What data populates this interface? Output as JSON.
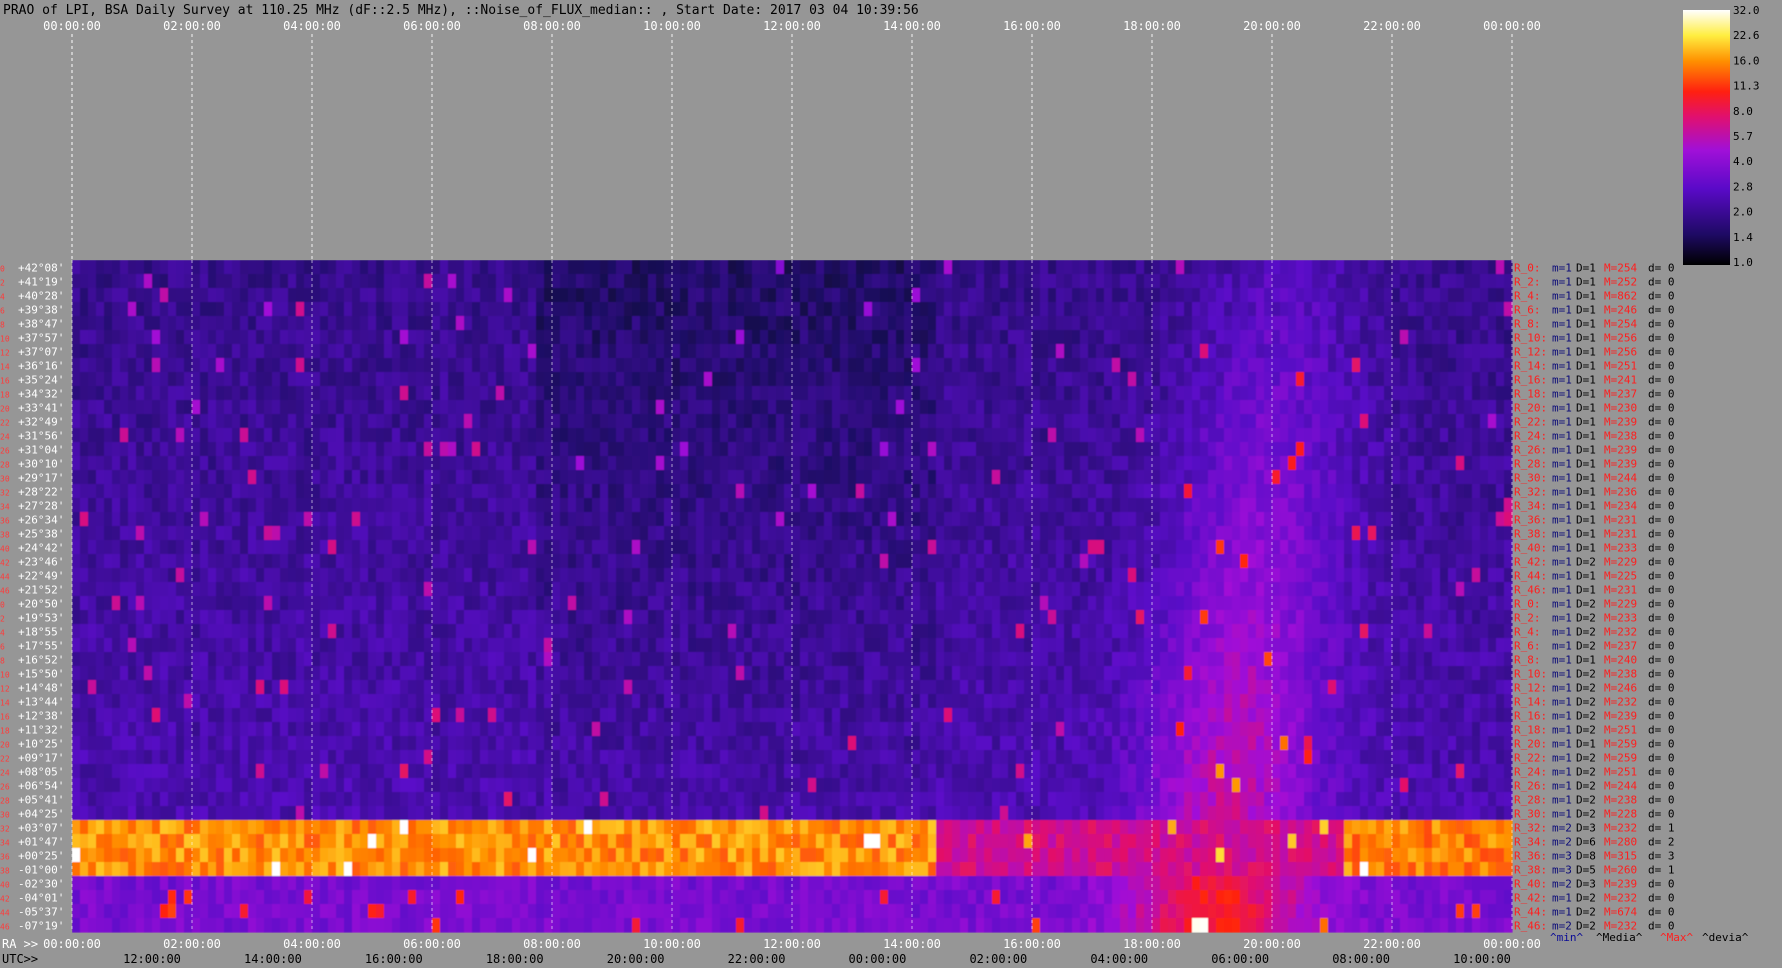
{
  "title": "PRAO of LPI, BSA Daily Survey at 110.25 MHz (dF::2.5 MHz), ::Noise_of_FLUX_median:: , Start Date: 2017 03 04 10:39:56",
  "colors": {
    "background": "#969696",
    "grid_dashed": "#ffffff",
    "title_text": "#000000",
    "ticks_top": "#ffffff",
    "row_index": "#ff3a3a",
    "dec_text": "#ffffff",
    "stat_r": "#ff1e1e",
    "stat_min": "#0a0a78",
    "stat_max": "#ff1e1e",
    "legend_min": "#0a0a96",
    "legend_media": "#000000",
    "legend_max": "#ff1e1e",
    "legend_devia": "#000000"
  },
  "chart_data": {
    "type": "heatmap",
    "title": "PRAO of LPI, BSA Daily Survey at 110.25 MHz (dF::2.5 MHz), ::Noise_of_FLUX_median:: , Start Date: 2017 03 04 10:39:56",
    "top_axis_ticks": [
      "00:00:00",
      "02:00:00",
      "04:00:00",
      "06:00:00",
      "08:00:00",
      "10:00:00",
      "12:00:00",
      "14:00:00",
      "16:00:00",
      "18:00:00",
      "20:00:00",
      "22:00:00",
      "00:00:00"
    ],
    "ra_axis": {
      "label": "RA >>",
      "ticks": [
        "00:00:00",
        "02:00:00",
        "04:00:00",
        "06:00:00",
        "08:00:00",
        "10:00:00",
        "12:00:00",
        "14:00:00",
        "16:00:00",
        "18:00:00",
        "20:00:00",
        "22:00:00",
        "00:00:00"
      ]
    },
    "utc_axis": {
      "label": "UTC>>",
      "ticks": [
        "12:00:00",
        "14:00:00",
        "16:00:00",
        "18:00:00",
        "20:00:00",
        "22:00:00",
        "00:00:00",
        "02:00:00",
        "04:00:00",
        "06:00:00",
        "08:00:00",
        "10:00:00"
      ]
    },
    "colorbar": {
      "labels": [
        "32.0",
        "22.6",
        "16.0",
        "11.3",
        "8.0",
        "5.7",
        "4.0",
        "2.8",
        "2.0",
        "1.4",
        "1.0"
      ]
    },
    "legend": {
      "min": "^min^",
      "media": "^Media^",
      "max": "^Max^",
      "devia": "^devia^"
    },
    "rows": [
      {
        "idx": "0",
        "dec": "+42°08'",
        "r": "R_0:",
        "m": "m=1",
        "D": "D=1",
        "M": "M=254",
        "d": "d= 0"
      },
      {
        "idx": "2",
        "dec": "+41°19'",
        "r": "R_2:",
        "m": "m=1",
        "D": "D=1",
        "M": "M=252",
        "d": "d= 0"
      },
      {
        "idx": "4",
        "dec": "+40°28'",
        "r": "R_4:",
        "m": "m=1",
        "D": "D=1",
        "M": "M=862",
        "d": "d= 0"
      },
      {
        "idx": "6",
        "dec": "+39°38'",
        "r": "R_6:",
        "m": "m=1",
        "D": "D=1",
        "M": "M=246",
        "d": "d= 0"
      },
      {
        "idx": "8",
        "dec": "+38°47'",
        "r": "R_8:",
        "m": "m=1",
        "D": "D=1",
        "M": "M=254",
        "d": "d= 0"
      },
      {
        "idx": "10",
        "dec": "+37°57'",
        "r": "R_10:",
        "m": "m=1",
        "D": "D=1",
        "M": "M=256",
        "d": "d= 0"
      },
      {
        "idx": "12",
        "dec": "+37°07'",
        "r": "R_12:",
        "m": "m=1",
        "D": "D=1",
        "M": "M=256",
        "d": "d= 0"
      },
      {
        "idx": "14",
        "dec": "+36°16'",
        "r": "R_14:",
        "m": "m=1",
        "D": "D=1",
        "M": "M=251",
        "d": "d= 0"
      },
      {
        "idx": "16",
        "dec": "+35°24'",
        "r": "R_16:",
        "m": "m=1",
        "D": "D=1",
        "M": "M=241",
        "d": "d= 0"
      },
      {
        "idx": "18",
        "dec": "+34°32'",
        "r": "R_18:",
        "m": "m=1",
        "D": "D=1",
        "M": "M=237",
        "d": "d= 0"
      },
      {
        "idx": "20",
        "dec": "+33°41'",
        "r": "R_20:",
        "m": "m=1",
        "D": "D=1",
        "M": "M=230",
        "d": "d= 0"
      },
      {
        "idx": "22",
        "dec": "+32°49'",
        "r": "R_22:",
        "m": "m=1",
        "D": "D=1",
        "M": "M=239",
        "d": "d= 0"
      },
      {
        "idx": "24",
        "dec": "+31°56'",
        "r": "R_24:",
        "m": "m=1",
        "D": "D=1",
        "M": "M=238",
        "d": "d= 0"
      },
      {
        "idx": "26",
        "dec": "+31°04'",
        "r": "R_26:",
        "m": "m=1",
        "D": "D=1",
        "M": "M=239",
        "d": "d= 0"
      },
      {
        "idx": "28",
        "dec": "+30°10'",
        "r": "R_28:",
        "m": "m=1",
        "D": "D=1",
        "M": "M=239",
        "d": "d= 0"
      },
      {
        "idx": "30",
        "dec": "+29°17'",
        "r": "R_30:",
        "m": "m=1",
        "D": "D=1",
        "M": "M=244",
        "d": "d= 0"
      },
      {
        "idx": "32",
        "dec": "+28°22'",
        "r": "R_32:",
        "m": "m=1",
        "D": "D=1",
        "M": "M=236",
        "d": "d= 0"
      },
      {
        "idx": "34",
        "dec": "+27°28'",
        "r": "R_34:",
        "m": "m=1",
        "D": "D=1",
        "M": "M=234",
        "d": "d= 0"
      },
      {
        "idx": "36",
        "dec": "+26°34'",
        "r": "R_36:",
        "m": "m=1",
        "D": "D=1",
        "M": "M=231",
        "d": "d= 0"
      },
      {
        "idx": "38",
        "dec": "+25°38'",
        "r": "R_38:",
        "m": "m=1",
        "D": "D=1",
        "M": "M=231",
        "d": "d= 0"
      },
      {
        "idx": "40",
        "dec": "+24°42'",
        "r": "R_40:",
        "m": "m=1",
        "D": "D=1",
        "M": "M=233",
        "d": "d= 0"
      },
      {
        "idx": "42",
        "dec": "+23°46'",
        "r": "R_42:",
        "m": "m=1",
        "D": "D=2",
        "M": "M=229",
        "d": "d= 0"
      },
      {
        "idx": "44",
        "dec": "+22°49'",
        "r": "R_44:",
        "m": "m=1",
        "D": "D=1",
        "M": "M=225",
        "d": "d= 0"
      },
      {
        "idx": "46",
        "dec": "+21°52'",
        "r": "R_46:",
        "m": "m=1",
        "D": "D=1",
        "M": "M=231",
        "d": "d= 0"
      },
      {
        "idx": "0",
        "dec": "+20°50'",
        "r": "R_0:",
        "m": "m=1",
        "D": "D=2",
        "M": "M=229",
        "d": "d= 0"
      },
      {
        "idx": "2",
        "dec": "+19°53'",
        "r": "R_2:",
        "m": "m=1",
        "D": "D=2",
        "M": "M=233",
        "d": "d= 0"
      },
      {
        "idx": "4",
        "dec": "+18°55'",
        "r": "R_4:",
        "m": "m=1",
        "D": "D=2",
        "M": "M=232",
        "d": "d= 0"
      },
      {
        "idx": "6",
        "dec": "+17°55'",
        "r": "R_6:",
        "m": "m=1",
        "D": "D=2",
        "M": "M=237",
        "d": "d= 0"
      },
      {
        "idx": "8",
        "dec": "+16°52'",
        "r": "R_8:",
        "m": "m=1",
        "D": "D=1",
        "M": "M=240",
        "d": "d= 0"
      },
      {
        "idx": "10",
        "dec": "+15°50'",
        "r": "R_10:",
        "m": "m=1",
        "D": "D=2",
        "M": "M=238",
        "d": "d= 0"
      },
      {
        "idx": "12",
        "dec": "+14°48'",
        "r": "R_12:",
        "m": "m=1",
        "D": "D=2",
        "M": "M=246",
        "d": "d= 0"
      },
      {
        "idx": "14",
        "dec": "+13°44'",
        "r": "R_14:",
        "m": "m=1",
        "D": "D=2",
        "M": "M=232",
        "d": "d= 0"
      },
      {
        "idx": "16",
        "dec": "+12°38'",
        "r": "R_16:",
        "m": "m=1",
        "D": "D=2",
        "M": "M=239",
        "d": "d= 0"
      },
      {
        "idx": "18",
        "dec": "+11°32'",
        "r": "R_18:",
        "m": "m=1",
        "D": "D=2",
        "M": "M=251",
        "d": "d= 0"
      },
      {
        "idx": "20",
        "dec": "+10°25'",
        "r": "R_20:",
        "m": "m=1",
        "D": "D=1",
        "M": "M=259",
        "d": "d= 0"
      },
      {
        "idx": "22",
        "dec": "+09°17'",
        "r": "R_22:",
        "m": "m=1",
        "D": "D=2",
        "M": "M=259",
        "d": "d= 0"
      },
      {
        "idx": "24",
        "dec": "+08°05'",
        "r": "R_24:",
        "m": "m=1",
        "D": "D=2",
        "M": "M=251",
        "d": "d= 0"
      },
      {
        "idx": "26",
        "dec": "+06°54'",
        "r": "R_26:",
        "m": "m=1",
        "D": "D=2",
        "M": "M=244",
        "d": "d= 0"
      },
      {
        "idx": "28",
        "dec": "+05°41'",
        "r": "R_28:",
        "m": "m=1",
        "D": "D=2",
        "M": "M=238",
        "d": "d= 0"
      },
      {
        "idx": "30",
        "dec": "+04°25'",
        "r": "R_30:",
        "m": "m=1",
        "D": "D=2",
        "M": "M=228",
        "d": "d= 0"
      },
      {
        "idx": "32",
        "dec": "+03°07'",
        "r": "R_32:",
        "m": "m=2",
        "D": "D=3",
        "M": "M=232",
        "d": "d= 1"
      },
      {
        "idx": "34",
        "dec": "+01°47'",
        "r": "R_34:",
        "m": "m=2",
        "D": "D=6",
        "M": "M=280",
        "d": "d= 2"
      },
      {
        "idx": "36",
        "dec": "+00°25'",
        "r": "R_36:",
        "m": "m=3",
        "D": "D=8",
        "M": "M=315",
        "d": "d= 3"
      },
      {
        "idx": "38",
        "dec": "-01°00'",
        "r": "R_38:",
        "m": "m=3",
        "D": "D=5",
        "M": "M=260",
        "d": "d= 1"
      },
      {
        "idx": "40",
        "dec": "-02°30'",
        "r": "R_40:",
        "m": "m=2",
        "D": "D=3",
        "M": "M=239",
        "d": "d= 0"
      },
      {
        "idx": "42",
        "dec": "-04°01'",
        "r": "R_42:",
        "m": "m=1",
        "D": "D=2",
        "M": "M=232",
        "d": "d= 0"
      },
      {
        "idx": "44",
        "dec": "-05°37'",
        "r": "R_44:",
        "m": "m=1",
        "D": "D=2",
        "M": "M=674",
        "d": "d= 0"
      },
      {
        "idx": "46",
        "dec": "-07°19'",
        "r": "R_46:",
        "m": "m=2",
        "D": "D=2",
        "M": "M=232",
        "d": "d= 0"
      }
    ]
  }
}
